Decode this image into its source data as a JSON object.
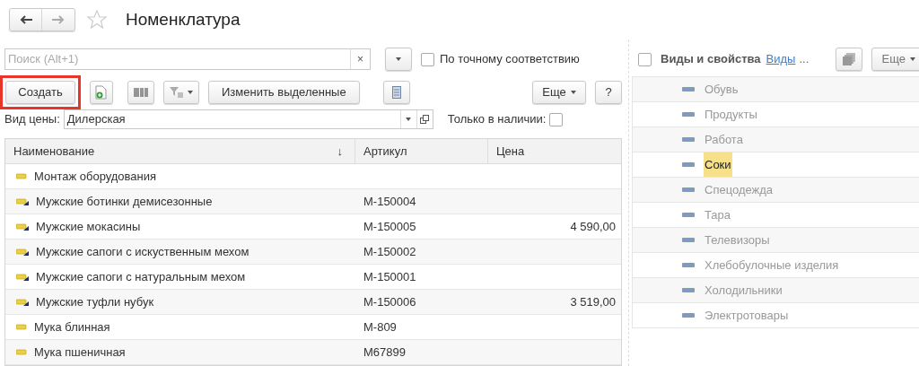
{
  "window": {
    "title": "Номенклатура"
  },
  "search": {
    "placeholder": "Поиск (Alt+1)",
    "clear": "×",
    "exact_match": {
      "label": "По точному соответствию",
      "checked": false
    }
  },
  "toolbar": {
    "create": {
      "label": "Создать",
      "highlighted": true
    },
    "edit_selected": "Изменить выделенные",
    "more": "Еще",
    "help": "?"
  },
  "price_type": {
    "label": "Вид цены:",
    "value": "Дилерская"
  },
  "in_stock": {
    "label": "Только в наличии:",
    "checked": false
  },
  "table": {
    "columns": [
      "Наименование",
      "Артикул",
      "Цена"
    ],
    "sort_mark": "↓",
    "rows": [
      {
        "kind": "plain",
        "name": "Монтаж оборудования",
        "article": "",
        "price": ""
      },
      {
        "kind": "tagged",
        "name": "Мужские ботинки демисезонные",
        "article": "М-150004",
        "price": ""
      },
      {
        "kind": "tagged",
        "name": "Мужские мокасины",
        "article": "М-150005",
        "price": "4 590,00"
      },
      {
        "kind": "tagged",
        "name": "Мужские сапоги с искуственным мехом",
        "article": "М-150002",
        "price": ""
      },
      {
        "kind": "tagged",
        "name": "Мужские сапоги с натуральным мехом",
        "article": "М-150001",
        "price": ""
      },
      {
        "kind": "tagged",
        "name": "Мужские туфли нубук",
        "article": "М-150006",
        "price": "3 519,00"
      },
      {
        "kind": "plain",
        "name": "Мука блинная",
        "article": "М-809",
        "price": ""
      },
      {
        "kind": "plain",
        "name": "Мука пшеничная",
        "article": "М67899",
        "price": ""
      }
    ]
  },
  "side_panel": {
    "checkbox": {
      "label": "Виды и свойства",
      "checked": false
    },
    "link": "Виды",
    "ellipsis": "...",
    "more": "Еще",
    "items": [
      {
        "label": "Обувь",
        "selected": false
      },
      {
        "label": "Продукты",
        "selected": false
      },
      {
        "label": "Работа",
        "selected": false
      },
      {
        "label": "Соки",
        "selected": true
      },
      {
        "label": "Спецодежда",
        "selected": false
      },
      {
        "label": "Тара",
        "selected": false
      },
      {
        "label": "Телевизоры",
        "selected": false
      },
      {
        "label": "Хлебобулочные изделия",
        "selected": false
      },
      {
        "label": "Холодильники",
        "selected": false
      },
      {
        "label": "Электротовары",
        "selected": false
      }
    ]
  }
}
